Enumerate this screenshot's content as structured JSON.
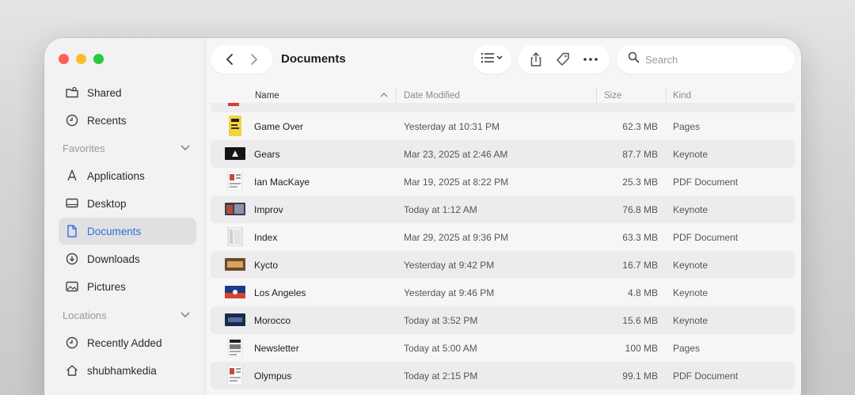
{
  "window": {
    "title": "Documents"
  },
  "sidebar": {
    "top_items": [
      {
        "label": "Shared",
        "icon": "shared-folder-icon"
      },
      {
        "label": "Recents",
        "icon": "clock-icon"
      }
    ],
    "favorites_label": "Favorites",
    "favorites": [
      {
        "label": "Applications",
        "icon": "applications-icon"
      },
      {
        "label": "Desktop",
        "icon": "desktop-icon"
      },
      {
        "label": "Documents",
        "icon": "document-icon",
        "active": true
      },
      {
        "label": "Downloads",
        "icon": "download-icon"
      },
      {
        "label": "Pictures",
        "icon": "photo-icon"
      }
    ],
    "locations_label": "Locations",
    "locations": [
      {
        "label": "Recently Added",
        "icon": "clock-icon"
      },
      {
        "label": "shubhamkedia",
        "icon": "home-icon"
      }
    ]
  },
  "search": {
    "placeholder": "Search"
  },
  "columns": {
    "name": "Name",
    "date": "Date Modified",
    "size": "Size",
    "kind": "Kind"
  },
  "files": [
    {
      "name": "Game Over",
      "date": "Yesterday at 10:31 PM",
      "size": "62.3 MB",
      "kind": "Pages",
      "thumb": "pages-yellow"
    },
    {
      "name": "Gears",
      "date": "Mar 23, 2025 at 2:46 AM",
      "size": "87.7 MB",
      "kind": "Keynote",
      "thumb": "keynote-dark"
    },
    {
      "name": "Ian MacKaye",
      "date": "Mar 19, 2025 at 8:22 PM",
      "size": "25.3 MB",
      "kind": "PDF Document",
      "thumb": "pdf-page"
    },
    {
      "name": "Improv",
      "date": "Today at 1:12 AM",
      "size": "76.8 MB",
      "kind": "Keynote",
      "thumb": "keynote-photo"
    },
    {
      "name": "Index",
      "date": "Mar 29, 2025 at 9:36 PM",
      "size": "63.3 MB",
      "kind": "PDF Document",
      "thumb": "pdf-grey"
    },
    {
      "name": "Kycto",
      "date": "Yesterday at 9:42 PM",
      "size": "16.7 MB",
      "kind": "Keynote",
      "thumb": "keynote-warm"
    },
    {
      "name": "Los Angeles",
      "date": "Yesterday at 9:46 PM",
      "size": "4.8 MB",
      "kind": "Keynote",
      "thumb": "keynote-blue"
    },
    {
      "name": "Morocco",
      "date": "Today at 3:52 PM",
      "size": "15.6 MB",
      "kind": "Keynote",
      "thumb": "keynote-navy"
    },
    {
      "name": "Newsletter",
      "date": "Today at 5:00 AM",
      "size": "100 MB",
      "kind": "Pages",
      "thumb": "pages-news"
    },
    {
      "name": "Olympus",
      "date": "Today at 2:15 PM",
      "size": "99.1 MB",
      "kind": "PDF Document",
      "thumb": "pdf-page"
    }
  ],
  "colors": {
    "accent": "#2f6fd8",
    "traffic_red": "#ff5f57",
    "traffic_yellow": "#febc2e",
    "traffic_green": "#28c840"
  }
}
